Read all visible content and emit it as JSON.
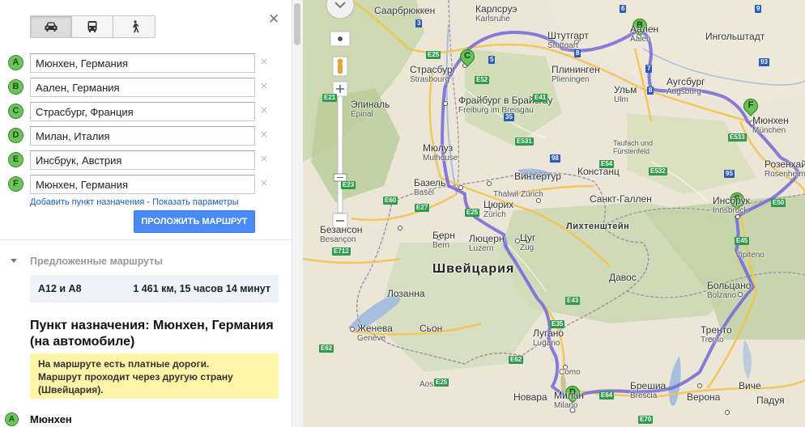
{
  "panel": {
    "close": "✕",
    "modes": [
      {
        "name": "car",
        "icon": "car-icon",
        "active": true
      },
      {
        "name": "transit",
        "icon": "bus-icon",
        "active": false
      },
      {
        "name": "walk",
        "icon": "walk-icon",
        "active": false
      }
    ],
    "waypoints": [
      {
        "marker": "A",
        "value": "Мюнхен, Германия"
      },
      {
        "marker": "B",
        "value": "Аален, Германия"
      },
      {
        "marker": "C",
        "value": "Страсбург, Франция"
      },
      {
        "marker": "D",
        "value": "Милан, Италия"
      },
      {
        "marker": "E",
        "value": "Инсбрук, Австрия"
      },
      {
        "marker": "F",
        "value": "Мюнхен, Германия"
      }
    ],
    "remove_glyph": "×",
    "add_destination": "Добавить пункт назначения",
    "links_separator": " - ",
    "show_options": "Показать параметры",
    "route_button": "ПРОЛОЖИТЬ МАРШРУТ",
    "suggested_title": "Предложенные маршруты",
    "suggested": {
      "name": "A12 и A8",
      "summary": "1 461 км, 15 часов 14 минут"
    },
    "destination_title": "Пункт назначения: Мюнхен, Германия (на автомобиле)",
    "warning_line1": "На маршруте есть платные дороги.",
    "warning_line2": "Маршрут проходит через другую страну (Швейцария).",
    "leg_start": "Мюнхен",
    "leg_marker": "A"
  },
  "map": {
    "route_color": "#7466d8",
    "water_color": "#a5bfdd",
    "forest_color": "#b8cf9a",
    "cities": [
      {
        "id": "saarbrucken",
        "text": "Саарбрюккен"
      },
      {
        "id": "karlsruhe",
        "text": "Карлсруэ",
        "sub": "Karlsruhe"
      },
      {
        "id": "stuttgart",
        "text": "Штутгарт",
        "sub": "Stuttgart"
      },
      {
        "id": "aalen",
        "text": "Аален",
        "sub": "Aalen"
      },
      {
        "id": "ingolstadt",
        "text": "Ингольштадт"
      },
      {
        "id": "strasbourg",
        "text": "Страсбург",
        "sub": "Strasbourg"
      },
      {
        "id": "pliningen",
        "text": "Плининген",
        "sub": "Plieningen"
      },
      {
        "id": "augsburg",
        "text": "Аугсбург",
        "sub": "Augsburg"
      },
      {
        "id": "munchen",
        "text": "Мюнхен",
        "sub": "München"
      },
      {
        "id": "epinal",
        "text": "Эпиналь",
        "sub": "Épinal"
      },
      {
        "id": "freiburg",
        "text": "Фрайбург в Брайсгау",
        "sub": "Freiburg im Breisgau"
      },
      {
        "id": "ulm",
        "text": "Ульм",
        "sub": "Ulm"
      },
      {
        "id": "mulhouse",
        "text": "Мюлуз",
        "sub": "Mulhouse"
      },
      {
        "id": "tauf",
        "text": "Taufach und Fürstenfeld"
      },
      {
        "id": "rosenheim",
        "text": "Розенхайм",
        "sub": "Rosenheim"
      },
      {
        "id": "basel",
        "text": "Базель",
        "sub": "Basel"
      },
      {
        "id": "winterthur",
        "text": "Винтертур"
      },
      {
        "id": "konstanz",
        "text": "Констанц"
      },
      {
        "id": "innsbruck",
        "text": "Инсбрук",
        "sub": "Innsbruck"
      },
      {
        "id": "zurich",
        "text": "Цюрих",
        "sub": "Zürich"
      },
      {
        "id": "stgallen",
        "text": "Санкт-Галлен"
      },
      {
        "id": "besancon",
        "text": "Безансон",
        "sub": "Besançon"
      },
      {
        "id": "bern",
        "text": "Берн",
        "sub": "Bern"
      },
      {
        "id": "luzern",
        "text": "Люцерн",
        "sub": "Luzern"
      },
      {
        "id": "zug",
        "text": "Цуг",
        "sub": "Zug"
      },
      {
        "id": "davos",
        "text": "Давос"
      },
      {
        "id": "vipiteno",
        "text": "Vipiteno"
      },
      {
        "id": "bolzano",
        "text": "Больцано",
        "sub": "Bolzano"
      },
      {
        "id": "lausanne",
        "text": "Лозанна"
      },
      {
        "id": "sion",
        "text": "Сьон"
      },
      {
        "id": "lugano",
        "text": "Лугано",
        "sub": "Lugano"
      },
      {
        "id": "trento",
        "text": "Тренто",
        "sub": "Trento"
      },
      {
        "id": "geneve",
        "text": "Женева",
        "sub": "Genève"
      },
      {
        "id": "como",
        "text": "Como"
      },
      {
        "id": "milan",
        "text": "Милан",
        "sub": "Milano"
      },
      {
        "id": "brescia",
        "text": "Брешиа",
        "sub": "Brescia"
      },
      {
        "id": "verona",
        "text": "Верона"
      },
      {
        "id": "padua",
        "text": "Падуя"
      },
      {
        "id": "vicenza",
        "text": "Виче"
      },
      {
        "id": "novara",
        "text": "Новара"
      },
      {
        "id": "aosta",
        "text": "Aosta"
      },
      {
        "id": "thalwil",
        "text": "Thalwil Zürich"
      }
    ],
    "countries": [
      {
        "id": "switzerland",
        "text": "Швейцария"
      },
      {
        "id": "liechtenstein",
        "text": "Лихтенштейн"
      }
    ],
    "roads": [
      {
        "id": "e25a",
        "text": "E25"
      },
      {
        "id": "e52",
        "text": "E52"
      },
      {
        "id": "e21",
        "text": "E21"
      },
      {
        "id": "e41",
        "text": "E41"
      },
      {
        "id": "e531",
        "text": "E531"
      },
      {
        "id": "e23",
        "text": "E23"
      },
      {
        "id": "e60",
        "text": "E60"
      },
      {
        "id": "e54",
        "text": "E54"
      },
      {
        "id": "e532",
        "text": "E532"
      },
      {
        "id": "e533",
        "text": "E533"
      },
      {
        "id": "e45",
        "text": "E45"
      },
      {
        "id": "e43",
        "text": "E43"
      },
      {
        "id": "e35",
        "text": "E35"
      },
      {
        "id": "e62",
        "text": "E62"
      },
      {
        "id": "e25b",
        "text": "E25"
      },
      {
        "id": "e64",
        "text": "E64"
      },
      {
        "id": "e70",
        "text": "E70"
      },
      {
        "id": "e62b",
        "text": "E62"
      },
      {
        "id": "e27",
        "text": "E27"
      },
      {
        "id": "e25c",
        "text": "E25"
      },
      {
        "id": "e712",
        "text": "E712"
      },
      {
        "id": "r5",
        "text": "5"
      },
      {
        "id": "r8",
        "text": "8"
      },
      {
        "id": "r6",
        "text": "6"
      },
      {
        "id": "r7",
        "text": "7"
      },
      {
        "id": "r93",
        "text": "93"
      },
      {
        "id": "r9",
        "text": "9"
      },
      {
        "id": "r95",
        "text": "95"
      },
      {
        "id": "r98",
        "text": "98"
      },
      {
        "id": "r8b",
        "text": "8"
      },
      {
        "id": "r3",
        "text": "3"
      },
      {
        "id": "r35",
        "text": "35"
      },
      {
        "id": "e50",
        "text": "E50"
      }
    ],
    "markers": [
      {
        "id": "A-marker-map",
        "letter": "B"
      },
      {
        "id": "C",
        "letter": "C"
      },
      {
        "id": "D",
        "letter": "D"
      },
      {
        "id": "E",
        "letter": "E"
      },
      {
        "id": "F",
        "letter": "F"
      }
    ]
  }
}
